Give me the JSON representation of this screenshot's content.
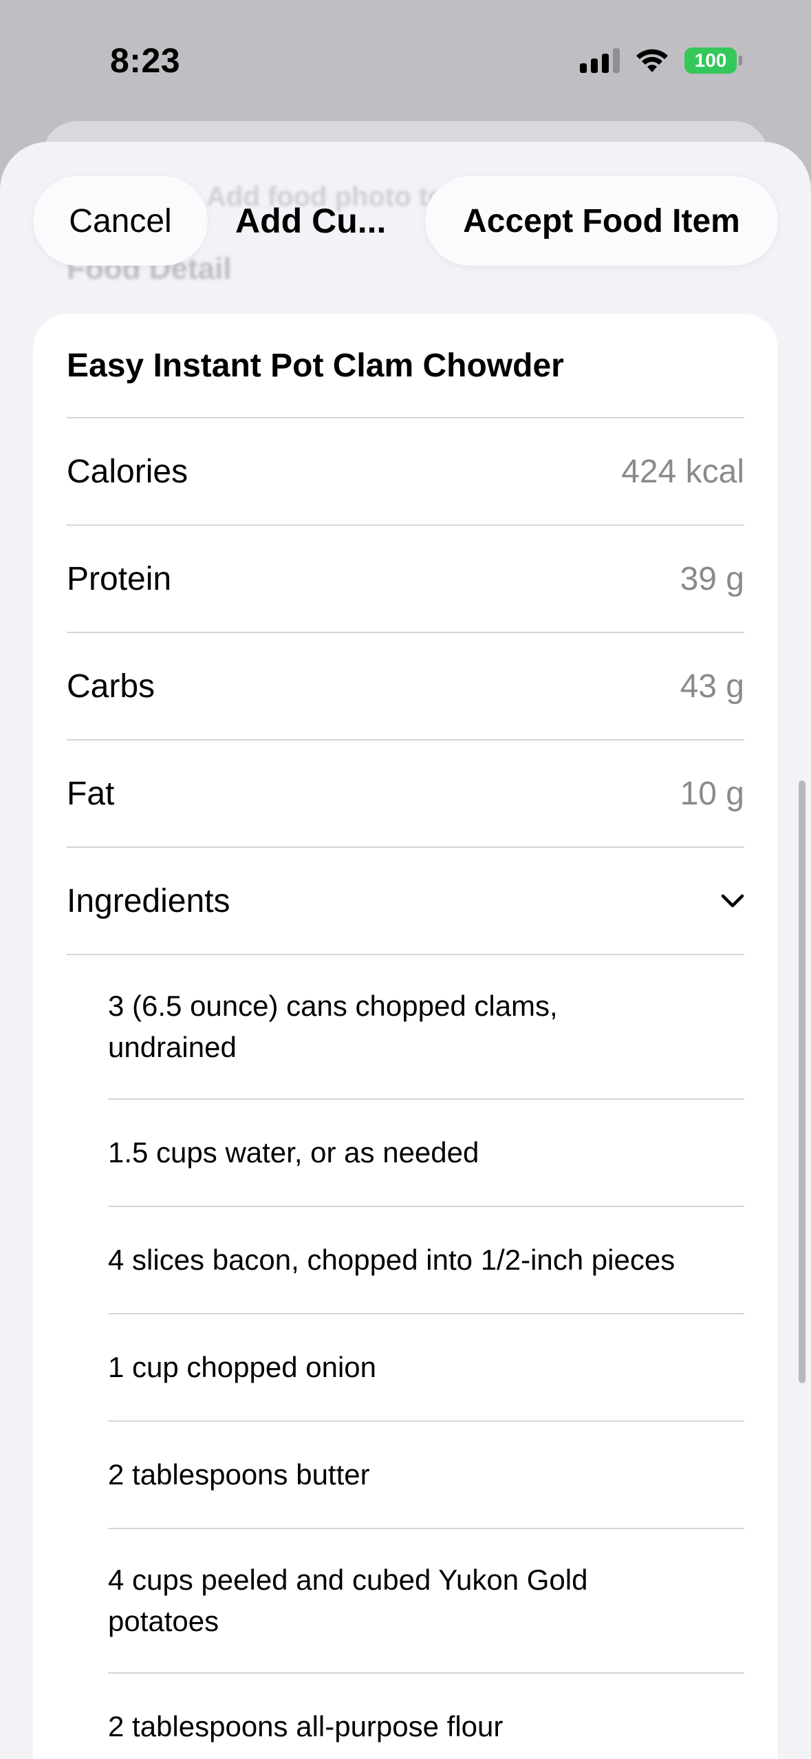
{
  "status_bar": {
    "time": "8:23",
    "battery": "100"
  },
  "background": {
    "ghost_line_1": "Add food photo to analyze",
    "ghost_line_2": "Food Detail"
  },
  "header": {
    "cancel_label": "Cancel",
    "title": "Add Cu...",
    "accept_label": "Accept Food Item"
  },
  "food": {
    "name": "Easy Instant Pot Clam Chowder",
    "nutrients": [
      {
        "label": "Calories",
        "value": "424 kcal"
      },
      {
        "label": "Protein",
        "value": "39 g"
      },
      {
        "label": "Carbs",
        "value": "43 g"
      },
      {
        "label": "Fat",
        "value": "10 g"
      }
    ],
    "ingredients_label": "Ingredients",
    "ingredients": [
      "3 (6.5 ounce) cans chopped clams, undrained",
      "1.5 cups water, or as needed",
      "4 slices bacon, chopped into 1/2-inch pieces",
      "1 cup chopped onion",
      "2 tablespoons butter",
      "4 cups peeled and cubed Yukon Gold potatoes",
      "2 tablespoons all-purpose flour"
    ]
  },
  "colors": {
    "accent_battery": "#34c759",
    "muted_text": "#8a8a8e",
    "sheet_bg": "#f2f2f7"
  }
}
